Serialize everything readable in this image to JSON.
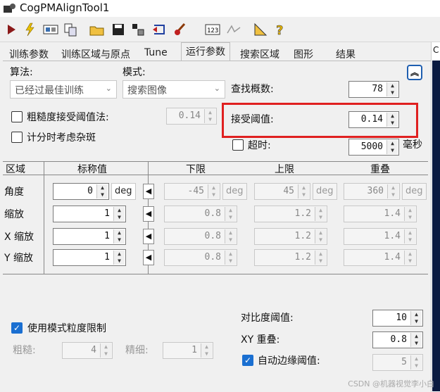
{
  "window": {
    "title": "CogPMAlignTool1"
  },
  "toolbar": {
    "icons": [
      "run-icon",
      "electric-run-icon",
      "display-icon",
      "copy-icon",
      "open-folder-icon",
      "save-icon",
      "import-icon",
      "reset-icon",
      "brush-icon",
      "number-123-icon",
      "signature-icon",
      "measure-icon",
      "help-icon"
    ]
  },
  "tabs": [
    "训练参数",
    "训练区域与原点",
    "Tune",
    "运行参数",
    "搜索区域",
    "图形",
    "结果"
  ],
  "active_tab": "运行参数",
  "params": {
    "algorithm_label": "算法:",
    "algorithm_value": "已经过最佳训练",
    "mode_label": "模式:",
    "mode_value": "搜索图像",
    "find_count_label": "查找概数:",
    "find_count_value": "78",
    "coarse_accept_label": "粗糙度接受阈值法:",
    "coarse_accept_value": "0.14",
    "accept_threshold_label": "接受阈值:",
    "accept_threshold_value": "0.14",
    "clutter_label": "计分时考虑杂斑",
    "timeout_label": "超时:",
    "timeout_value": "5000",
    "timeout_unit": "毫秒"
  },
  "table": {
    "headers": [
      "区域",
      "标称值",
      "下限",
      "上限",
      "重叠"
    ],
    "rows": [
      {
        "name": "角度",
        "nominal": "0",
        "unit": "deg",
        "low": "-45",
        "high": "45",
        "overlap": "360"
      },
      {
        "name": "缩放",
        "nominal": "1",
        "unit": "",
        "low": "0.8",
        "high": "1.2",
        "overlap": "1.4"
      },
      {
        "name": "X 缩放",
        "nominal": "1",
        "unit": "",
        "low": "0.8",
        "high": "1.2",
        "overlap": "1.4"
      },
      {
        "name": "Y 缩放",
        "nominal": "1",
        "unit": "",
        "low": "0.8",
        "high": "1.2",
        "overlap": "1.4"
      }
    ],
    "limit_unit": "deg"
  },
  "bottom": {
    "granularity_label": "使用模式粒度限制",
    "coarse_label": "粗糙:",
    "coarse_value": "4",
    "fine_label": "精细:",
    "fine_value": "1",
    "contrast_label": "对比度阈值:",
    "contrast_value": "10",
    "xy_overlap_label": "XY 重叠:",
    "xy_overlap_value": "0.8",
    "auto_edge_label": "自动边缘阈值:",
    "auto_edge_value": "5"
  },
  "watermark": "CSDN @机器视觉李小白",
  "colors": {
    "highlight": "#e02020",
    "check": "#1a6fd1"
  }
}
